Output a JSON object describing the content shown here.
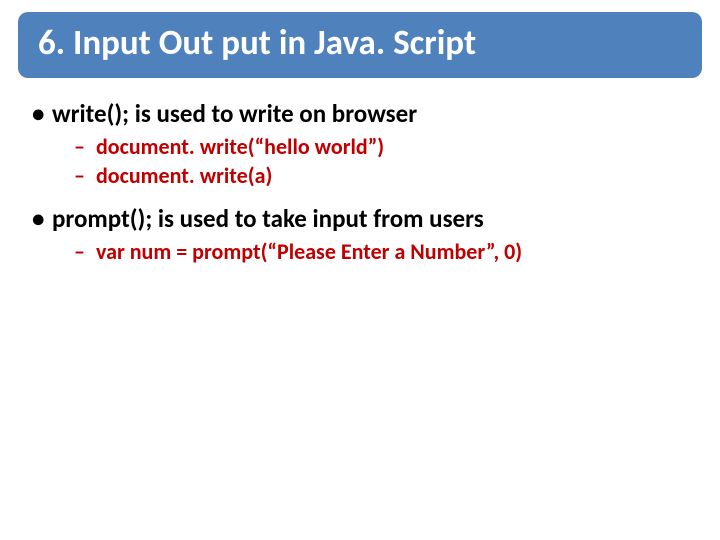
{
  "title": "6. Input Out put in Java. Script",
  "bullets": [
    {
      "level": 1,
      "text": "write(); is used to write on browser"
    },
    {
      "level": 2,
      "text": "document. write(“hello world”)"
    },
    {
      "level": 2,
      "text": "document. write(a)"
    },
    {
      "level": 1,
      "text": "prompt(); is used to take input from users"
    },
    {
      "level": 2,
      "text": "var  num = prompt(“Please Enter a Number”, 0)"
    }
  ]
}
